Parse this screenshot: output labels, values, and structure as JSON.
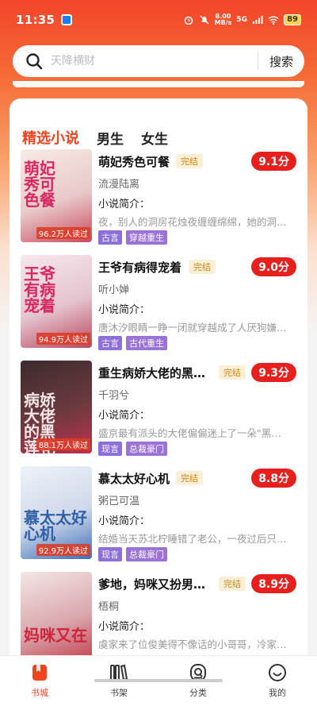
{
  "status_bar": {
    "time": "11:35",
    "net_speed": "8.00",
    "net_unit": "MB/s",
    "signal": "5G",
    "battery": "89"
  },
  "search": {
    "placeholder": "天降横财",
    "button_label": "搜索"
  },
  "tabs": [
    {
      "label": "精选小说",
      "active": true
    },
    {
      "label": "男生",
      "active": false
    },
    {
      "label": "女生",
      "active": false
    }
  ],
  "books": [
    {
      "cover_title": "萌妃秀可色餐",
      "reads": "96.2万人读过",
      "title": "萌妃秀色可餐",
      "status": "完结",
      "score": "9.1分",
      "author": "流漫陆离",
      "intro_label": "小说简介：",
      "intro": "夜，别人的洞房花烛夜缠缠绵绵，她的洞…",
      "tags": [
        "古言",
        "穿越重生"
      ],
      "cover_colors": [
        "#f7ebe6",
        "#e8c9c9",
        "#c94a5e"
      ]
    },
    {
      "cover_title": "王爷有病宠着",
      "reads": "94.9万人读过",
      "title": "王爷有病得宠着",
      "status": "完结",
      "score": "9.0分",
      "author": "听小婵",
      "intro_label": "小说简介：",
      "intro": "唐沐汐眼睛一睁一闭就穿越成了人厌狗嫌…",
      "tags": [
        "古言",
        "古代重生"
      ],
      "cover_colors": [
        "#f5e8ec",
        "#e5c4cf",
        "#b8485e"
      ]
    },
    {
      "cover_title": "病娇大佬的黑莲花",
      "reads": "88.1万人读过",
      "title": "重生病娇大佬的黑…",
      "status": "完结",
      "score": "9.3分",
      "author": "千羽兮",
      "intro_label": "小说简介：",
      "intro": "盛京最有派头的大佬偏偏迷上了一朵\"黑…",
      "tags": [
        "现言",
        "总裁豪门"
      ],
      "cover_colors": [
        "#3c2b2e",
        "#6b3a3e",
        "#c23050"
      ]
    },
    {
      "cover_title": "慕太太好心机",
      "reads": "92.9万人读过",
      "title": "慕太太好心机",
      "status": "完结",
      "score": "8.8分",
      "author": "粥已可温",
      "intro_label": "小说简介：",
      "intro": "结婚当天苏北柠睡错了老公，一夜过后只…",
      "tags": [
        "现言",
        "总裁豪门"
      ],
      "cover_colors": [
        "#eef2f8",
        "#cfd9ea",
        "#3d6fb8"
      ]
    },
    {
      "cover_title": "妈咪又在",
      "reads": "",
      "title": "爹地，妈咪又扮男…",
      "status": "完结",
      "score": "8.9分",
      "author": "梧桐",
      "intro_label": "小说简介：",
      "intro": "虞家来了位俊美得不像话的小哥哥，冷家…",
      "tags": [],
      "cover_colors": [
        "#f4e6e6",
        "#d9a8ad",
        "#c23a4a"
      ]
    }
  ],
  "bottom_nav": [
    {
      "label": "书城",
      "icon": "book-city-icon",
      "active": true
    },
    {
      "label": "书架",
      "icon": "bookshelf-icon",
      "active": false
    },
    {
      "label": "分类",
      "icon": "category-icon",
      "active": false
    },
    {
      "label": "我的",
      "icon": "profile-icon",
      "active": false
    }
  ],
  "colors": {
    "accent": "#f0431f",
    "score_bg": "#e8201d",
    "tag_bg": "#8c6fd8"
  }
}
